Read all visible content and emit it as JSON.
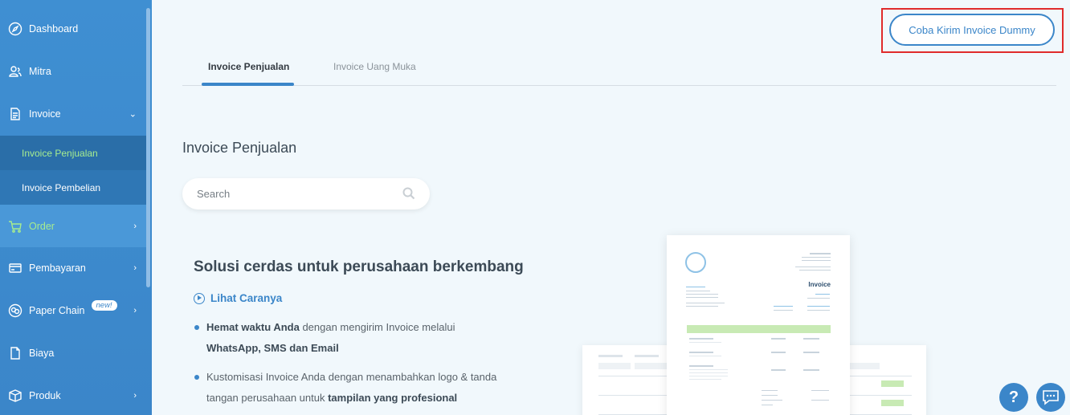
{
  "sidebar": {
    "items": [
      {
        "label": "Dashboard",
        "icon": "compass-icon"
      },
      {
        "label": "Mitra",
        "icon": "users-icon"
      },
      {
        "label": "Invoice",
        "icon": "document-icon"
      },
      {
        "label": "Order",
        "icon": "cart-icon"
      },
      {
        "label": "Pembayaran",
        "icon": "card-icon"
      },
      {
        "label": "Paper Chain",
        "icon": "chain-icon",
        "badge": "new!"
      },
      {
        "label": "Biaya",
        "icon": "receipt-icon"
      },
      {
        "label": "Produk",
        "icon": "box-icon"
      }
    ],
    "subitems": [
      {
        "label": "Invoice Penjualan",
        "active": true
      },
      {
        "label": "Invoice Pembelian",
        "active": false
      }
    ]
  },
  "top_button": "Coba Kirim Invoice Dummy",
  "tabs": [
    {
      "label": "Invoice Penjualan",
      "active": true
    },
    {
      "label": "Invoice Uang Muka",
      "active": false
    }
  ],
  "page_title": "Invoice Penjualan",
  "search": {
    "placeholder": "Search"
  },
  "promo": {
    "headline": "Solusi cerdas untuk perusahaan berkembang",
    "link": "Lihat Caranya",
    "bullet1_bold": "Hemat waktu Anda",
    "bullet1_text": " dengan mengirim Invoice melalui ",
    "bullet1_bold2": "WhatsApp, SMS dan Email",
    "bullet2_text": "Kustomisasi Invoice Anda dengan menambahkan logo & tanda tangan perusahaan untuk ",
    "bullet2_bold": "tampilan yang profesional"
  },
  "illustration": {
    "doc_title": "Invoice"
  },
  "floating": {
    "help": "?"
  },
  "colors": {
    "primary": "#3b86c9",
    "active_sub": "#a6ec8f",
    "highlight": "#e02b2b"
  }
}
